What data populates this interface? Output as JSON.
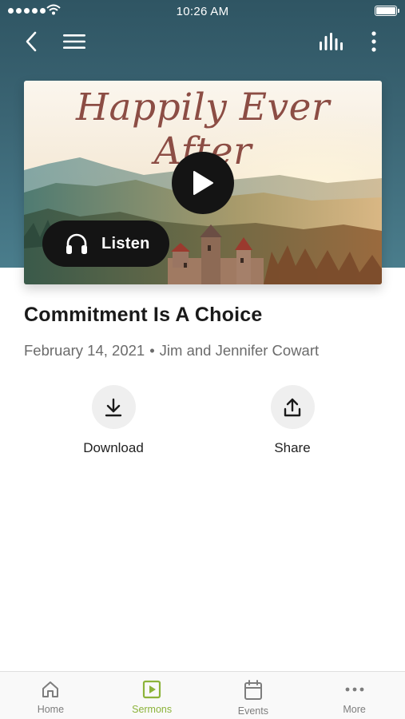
{
  "status_bar": {
    "time": "10:26 AM"
  },
  "nav": {
    "back_icon": "chevron-left-icon",
    "menu_icon": "hamburger-icon",
    "audio_icon": "audio-bars-icon",
    "more_icon": "vertical-dots-icon"
  },
  "hero": {
    "title": "Happily Ever After",
    "listen_label": "Listen",
    "title_color": "#8c4d44"
  },
  "sermon": {
    "title": "Commitment Is A Choice",
    "date": "February 14, 2021",
    "separator": "•",
    "speakers": "Jim and Jennifer Cowart"
  },
  "actions": {
    "download_label": "Download",
    "share_label": "Share"
  },
  "tabbar": {
    "tabs": [
      {
        "label": "Home",
        "icon": "home-icon",
        "active": false
      },
      {
        "label": "Sermons",
        "icon": "play-square-icon",
        "active": true
      },
      {
        "label": "Events",
        "icon": "calendar-icon",
        "active": false
      },
      {
        "label": "More",
        "icon": "more-dots-icon",
        "active": false
      }
    ],
    "accent": "#8cb33a"
  },
  "colors": {
    "header": "#3b6574",
    "play_button": "#141414"
  }
}
